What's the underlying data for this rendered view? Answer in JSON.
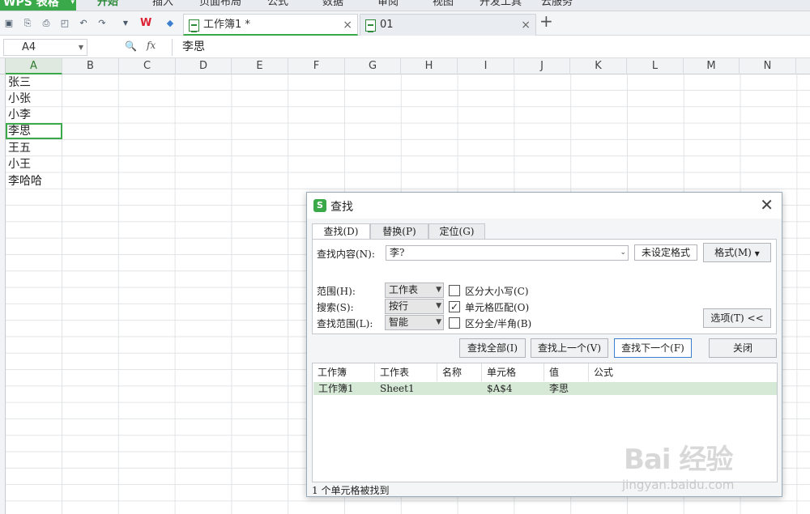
{
  "menubar": {
    "app_label": "WPS 表格",
    "items": [
      "开始",
      "插入",
      "页面布局",
      "公式",
      "数据",
      "审阅",
      "视图",
      "开发工具",
      "云服务"
    ]
  },
  "toolbar": {
    "icons": [
      "save-icon",
      "print-preview-icon",
      "print-icon",
      "preview-icon",
      "undo-icon",
      "redo-icon",
      "dropdown-icon",
      "wps-logo-icon",
      "cloud-icon"
    ],
    "tabs": [
      {
        "label": "工作簿1 *",
        "active": true
      },
      {
        "label": "01",
        "active": false
      }
    ],
    "close_glyph": "×",
    "add_glyph": "+"
  },
  "formula_bar": {
    "cell_ref": "A4",
    "fx_label": "fx",
    "content": "李思"
  },
  "sheet": {
    "columns": [
      "A",
      "B",
      "C",
      "D",
      "E",
      "F",
      "G",
      "H",
      "I",
      "J",
      "K",
      "L",
      "M",
      "N"
    ],
    "selected_column": "A",
    "cells_a": [
      "张三",
      "小张",
      "小李",
      "李思",
      "王五",
      "小王",
      "李哈哈"
    ],
    "active_cell_index": 3
  },
  "dialog": {
    "title": "查找",
    "logo": "S",
    "tabs": [
      "查找(D)",
      "替换(P)",
      "定位(G)"
    ],
    "active_tab": 0,
    "find_label": "查找内容(N):",
    "find_value": "李?",
    "no_format_label": "未设定格式",
    "format_button": "格式(M)",
    "scope_label": "范围(H):",
    "scope_value": "工作表",
    "search_label": "搜索(S):",
    "search_value": "按行",
    "look_in_label": "查找范围(L):",
    "look_in_value": "智能",
    "match_case_label": "区分大小写(C)",
    "match_case_checked": false,
    "match_cell_label": "单元格匹配(O)",
    "match_cell_checked": true,
    "match_width_label": "区分全/半角(B)",
    "match_width_checked": false,
    "options_button": "选项(T) <<",
    "find_all_button": "查找全部(I)",
    "find_prev_button": "查找上一个(V)",
    "find_next_button": "查找下一个(F)",
    "close_button": "关闭",
    "results_headers": [
      "工作簿",
      "工作表",
      "名称",
      "单元格",
      "值",
      "公式"
    ],
    "results_rows": [
      {
        "workbook": "工作簿1",
        "sheet": "Sheet1",
        "name": "",
        "cell": "$A$4",
        "value": "李思",
        "formula": ""
      }
    ],
    "status": "1 个单元格被找到"
  },
  "watermark": {
    "text": "Bai 经验",
    "sub": "jingyan.baidu.com"
  },
  "colors": {
    "accent": "#3aa94a",
    "selection_row": "#d6e9d6",
    "primary_border": "#3c7fd1"
  }
}
